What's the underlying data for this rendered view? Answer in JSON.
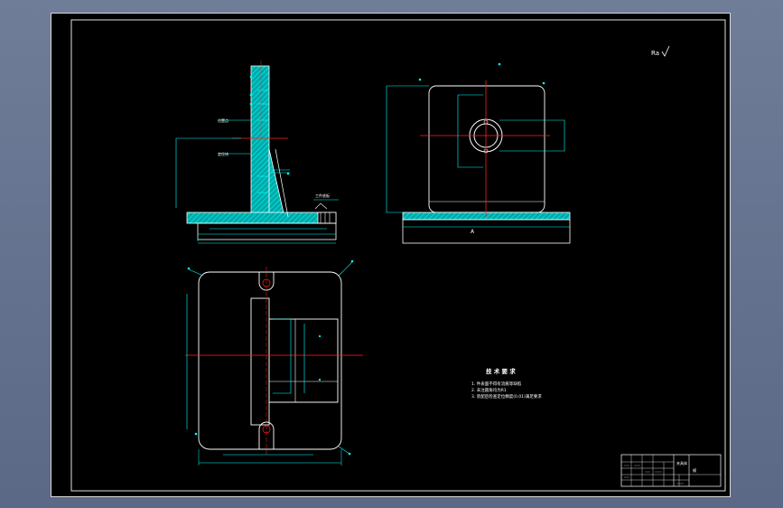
{
  "drawing": {
    "roughness_mark": "Ra",
    "section_label": "A",
    "leader_labels": {
      "l1": "位置点",
      "l2": "定位块",
      "l3": "工件底板"
    },
    "tech_requirements": {
      "title": "技 术 要 求",
      "items": [
        "1. 件表面不得有流痕等缺陷",
        "2. 未注圆角均为R1",
        "3. 装配后检查定位精度(0.01)满足要求"
      ]
    },
    "title_block": {
      "name": "夹具体",
      "cell": "模"
    }
  },
  "colors": {
    "background": "#000000",
    "outline": "#ffffff",
    "dimension": "#00ffff",
    "centerline": "#ff2020",
    "hatch": "#00c8c8"
  }
}
